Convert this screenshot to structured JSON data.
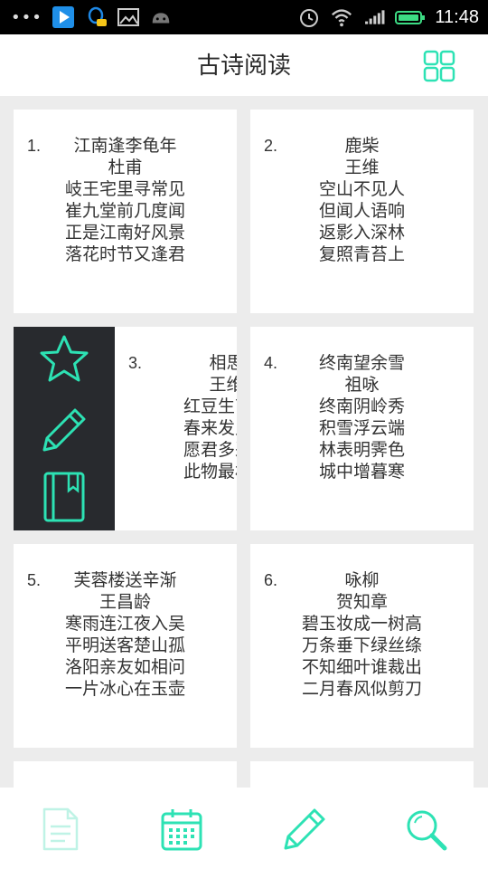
{
  "status_bar": {
    "time": "11:48",
    "icons": [
      "more-dots-icon",
      "play-store-icon",
      "qq-icon",
      "image-icon",
      "android-icon",
      "alarm-icon",
      "wifi-icon",
      "signal-icon",
      "battery-icon"
    ]
  },
  "header": {
    "title": "古诗阅读",
    "grid_icon": "grid-view-icon"
  },
  "poems": [
    {
      "number": "1.",
      "title": "江南逢李龟年",
      "author": "杜甫",
      "lines": [
        "岐王宅里寻常见",
        "崔九堂前几度闻",
        "正是江南好风景",
        "落花时节又逢君"
      ]
    },
    {
      "number": "2.",
      "title": "鹿柴",
      "author": "王维",
      "lines": [
        "空山不见人",
        "但闻人语响",
        "返影入深林",
        "复照青苔上"
      ]
    },
    {
      "number": "3.",
      "title": "相思",
      "author": "王维",
      "lines": [
        "红豆生南国",
        "春来发几枝",
        "愿君多采撷",
        "此物最相思"
      ]
    },
    {
      "number": "4.",
      "title": "终南望余雪",
      "author": "祖咏",
      "lines": [
        "终南阴岭秀",
        "积雪浮云端",
        "林表明霁色",
        "城中增暮寒"
      ]
    },
    {
      "number": "5.",
      "title": "芙蓉楼送辛渐",
      "author": "王昌龄",
      "lines": [
        "寒雨连江夜入吴",
        "平明送客楚山孤",
        "洛阳亲友如相问",
        "一片冰心在玉壶"
      ]
    },
    {
      "number": "6.",
      "title": "咏柳",
      "author": "贺知章",
      "lines": [
        "碧玉妆成一树高",
        "万条垂下绿丝绦",
        "不知细叶谁裁出",
        "二月春风似剪刀"
      ]
    }
  ],
  "swipe_actions": [
    "star-icon",
    "pencil-icon",
    "book-icon"
  ],
  "bottom_nav": [
    "document-icon",
    "calendar-icon",
    "pencil-icon",
    "search-icon"
  ],
  "colors": {
    "accent": "#2de2b4",
    "panel": "#282a2e",
    "background": "#ececec"
  }
}
